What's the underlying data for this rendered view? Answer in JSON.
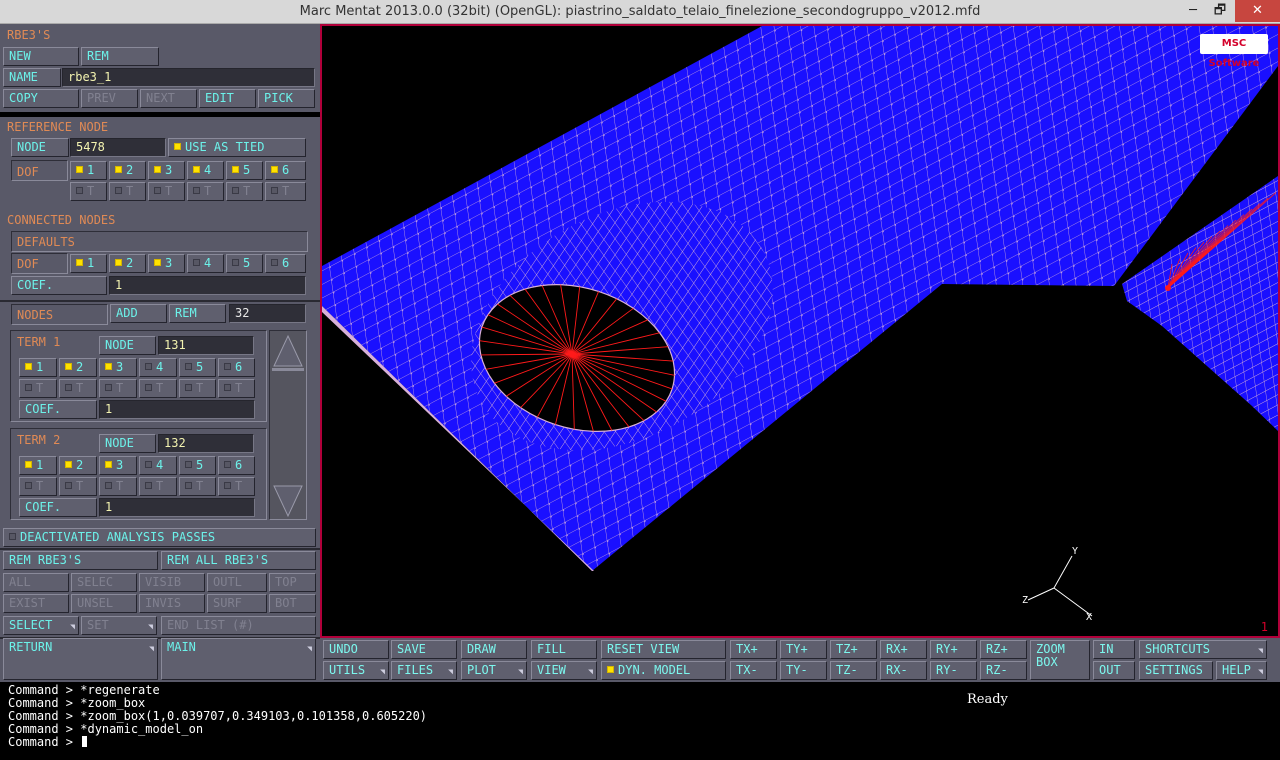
{
  "window": {
    "title": "Marc Mentat 2013.0.0 (32bit) (OpenGL): piastrino_saldato_telaio_finelezione_secondogruppo_v2012.mfd",
    "min": "─",
    "max": "🗗",
    "close": "✕"
  },
  "panel": {
    "heading": "RBE3'S",
    "new": "NEW",
    "rem": "REM",
    "name_label": "NAME",
    "name_value": "rbe3_1",
    "copy": "COPY",
    "prev": "PREV",
    "next": "NEXT",
    "edit": "EDIT",
    "pick": "PICK",
    "ref_heading": "REFERENCE NODE",
    "node_label": "NODE",
    "node_value": "5478",
    "use_as_tied": "USE AS TIED",
    "dof_label": "DOF",
    "dof": [
      "1",
      "2",
      "3",
      "4",
      "5",
      "6"
    ],
    "t_label": "T",
    "conn_heading": "CONNECTED NODES",
    "defaults": "DEFAULTS",
    "coef_label": "COEF.",
    "coef_value": "1",
    "nodes_label": "NODES",
    "add": "ADD",
    "nodes_rem": "REM",
    "nodes_count": "32",
    "term1": {
      "label": "TERM 1",
      "node_label": "NODE",
      "node": "131",
      "coef": "1"
    },
    "term2": {
      "label": "TERM 2",
      "node_label": "NODE",
      "node": "132",
      "coef": "1"
    },
    "deactivated": "DEACTIVATED ANALYSIS PASSES",
    "rem_rbe3": "REM RBE3'S",
    "rem_all": "REM ALL RBE3'S",
    "sel": [
      "ALL",
      "SELEC",
      "VISIB",
      "OUTL",
      "TOP",
      "EXIST",
      "UNSEL",
      "INVIS",
      "SURF",
      "BOT"
    ],
    "select": "SELECT",
    "set": "SET",
    "end_list": "END LIST (#)",
    "return": "RETURN",
    "main": "MAIN"
  },
  "viewport": {
    "logo": "MSC Software",
    "axes": {
      "x": "X",
      "y": "Y",
      "z": "Z"
    },
    "number": "1"
  },
  "toolbar": {
    "undo": "UNDO",
    "utils": "UTILS",
    "save": "SAVE",
    "files": "FILES",
    "draw": "DRAW",
    "plot": "PLOT",
    "fill": "FILL",
    "view": "VIEW",
    "reset_view": "RESET VIEW",
    "dyn_model": "DYN. MODEL",
    "txp": "TX+",
    "txm": "TX-",
    "typ": "TY+",
    "tym": "TY-",
    "tzp": "TZ+",
    "tzm": "TZ-",
    "rxp": "RX+",
    "rxm": "RX-",
    "ryp": "RY+",
    "rym": "RY-",
    "rzp": "RZ+",
    "rzm": "RZ-",
    "zoom_box_1": "ZOOM",
    "zoom_box_2": "BOX",
    "in": "IN",
    "out": "OUT",
    "shortcuts": "SHORTCUTS",
    "settings": "SETTINGS",
    "help": "HELP"
  },
  "console": {
    "lines": [
      "Command > *regenerate",
      "Command > *zoom_box",
      "Command > *zoom_box(1,0.039707,0.349103,0.101358,0.605220)",
      "Command > *dynamic_model_on",
      "Command > "
    ],
    "status": "Ready"
  },
  "colors": {
    "mesh_fill": "#1a10ff",
    "mesh_line": "#d8b0d8",
    "rbe_spider": "#ff1a1a",
    "panel_bg": "#595968",
    "button_text": "#6cf2ea",
    "heading_text": "#e08a55",
    "check_on": "#ffe200"
  }
}
